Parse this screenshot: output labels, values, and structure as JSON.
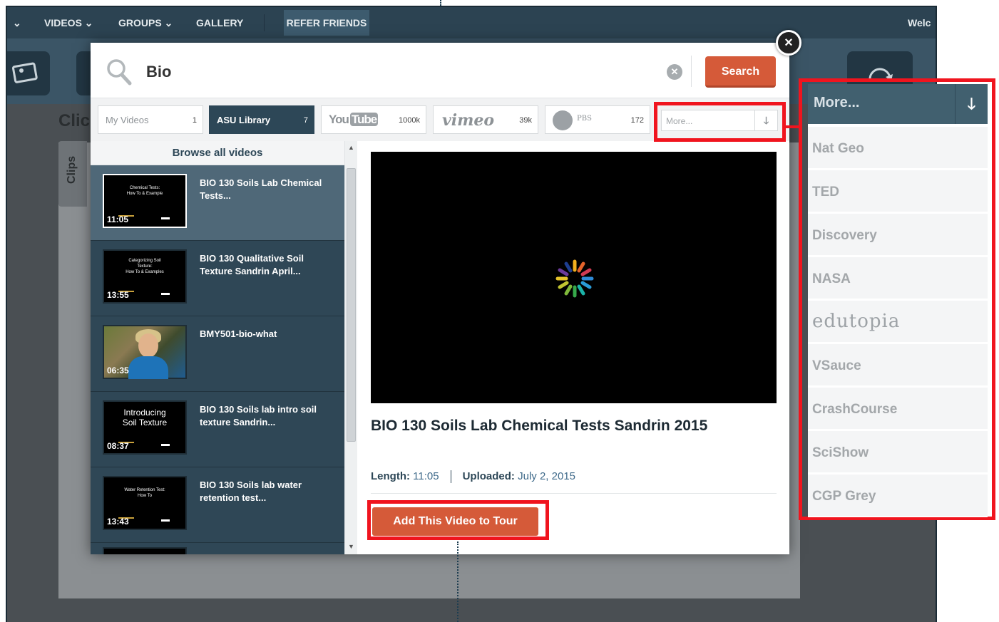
{
  "topnav": {
    "menu_label": "",
    "videos": "VIDEOS",
    "groups": "GROUPS",
    "gallery": "GALLERY",
    "refer": "REFER FRIENDS",
    "welcome": "Welc"
  },
  "page": {
    "title_partial": "Clic",
    "clips_tab": "Clips"
  },
  "search": {
    "value": "Bio",
    "button": "Search"
  },
  "tabs": [
    {
      "label": "My Videos",
      "count": "1"
    },
    {
      "label": "ASU Library",
      "count": "7"
    },
    {
      "label": "YouTube",
      "logo_a": "You",
      "logo_b": "Tube",
      "count": "1000k"
    },
    {
      "label": "vimeo",
      "count": "39k"
    },
    {
      "label": "PBS",
      "count": "172"
    },
    {
      "label": "More..."
    }
  ],
  "browse_label": "Browse all videos",
  "videos": [
    {
      "title": "BIO 130 Soils Lab Chemical Tests...",
      "duration": "11:05",
      "thumb_text": "Chemical Tests:\nHow To & Example",
      "selected": true
    },
    {
      "title": "BIO 130 Qualitative Soil Texture Sandrin April...",
      "duration": "13:55",
      "thumb_text": "Categorizing Soil\nTexture:\nHow To & Examples"
    },
    {
      "title": "BMY501-bio-what",
      "duration": "06:35",
      "thumb_text": ""
    },
    {
      "title": "BIO 130 Soils lab intro soil texture Sandrin...",
      "duration": "08:37",
      "thumb_text": "Introducing\nSoil Texture"
    },
    {
      "title": "BIO 130 Soils lab water retention test...",
      "duration": "13:43",
      "thumb_text": "Water Retention Test:\nHow To"
    }
  ],
  "detail": {
    "title": "BIO 130 Soils Lab Chemical Tests Sandrin 2015",
    "length_label": "Length:",
    "length": "11:05",
    "uploaded_label": "Uploaded:",
    "uploaded": "July 2, 2015",
    "add_button": "Add This Video to Tour"
  },
  "more_dropdown": {
    "label": "More...",
    "items": [
      "Nat Geo",
      "TED",
      "Discovery",
      "NASA",
      "edutopia",
      "VSauce",
      "CrashCourse",
      "SciShow",
      "CGP Grey"
    ]
  },
  "colors": {
    "accent": "#d55a39",
    "nav": "#2c4352",
    "highlight": "#f0141e"
  }
}
